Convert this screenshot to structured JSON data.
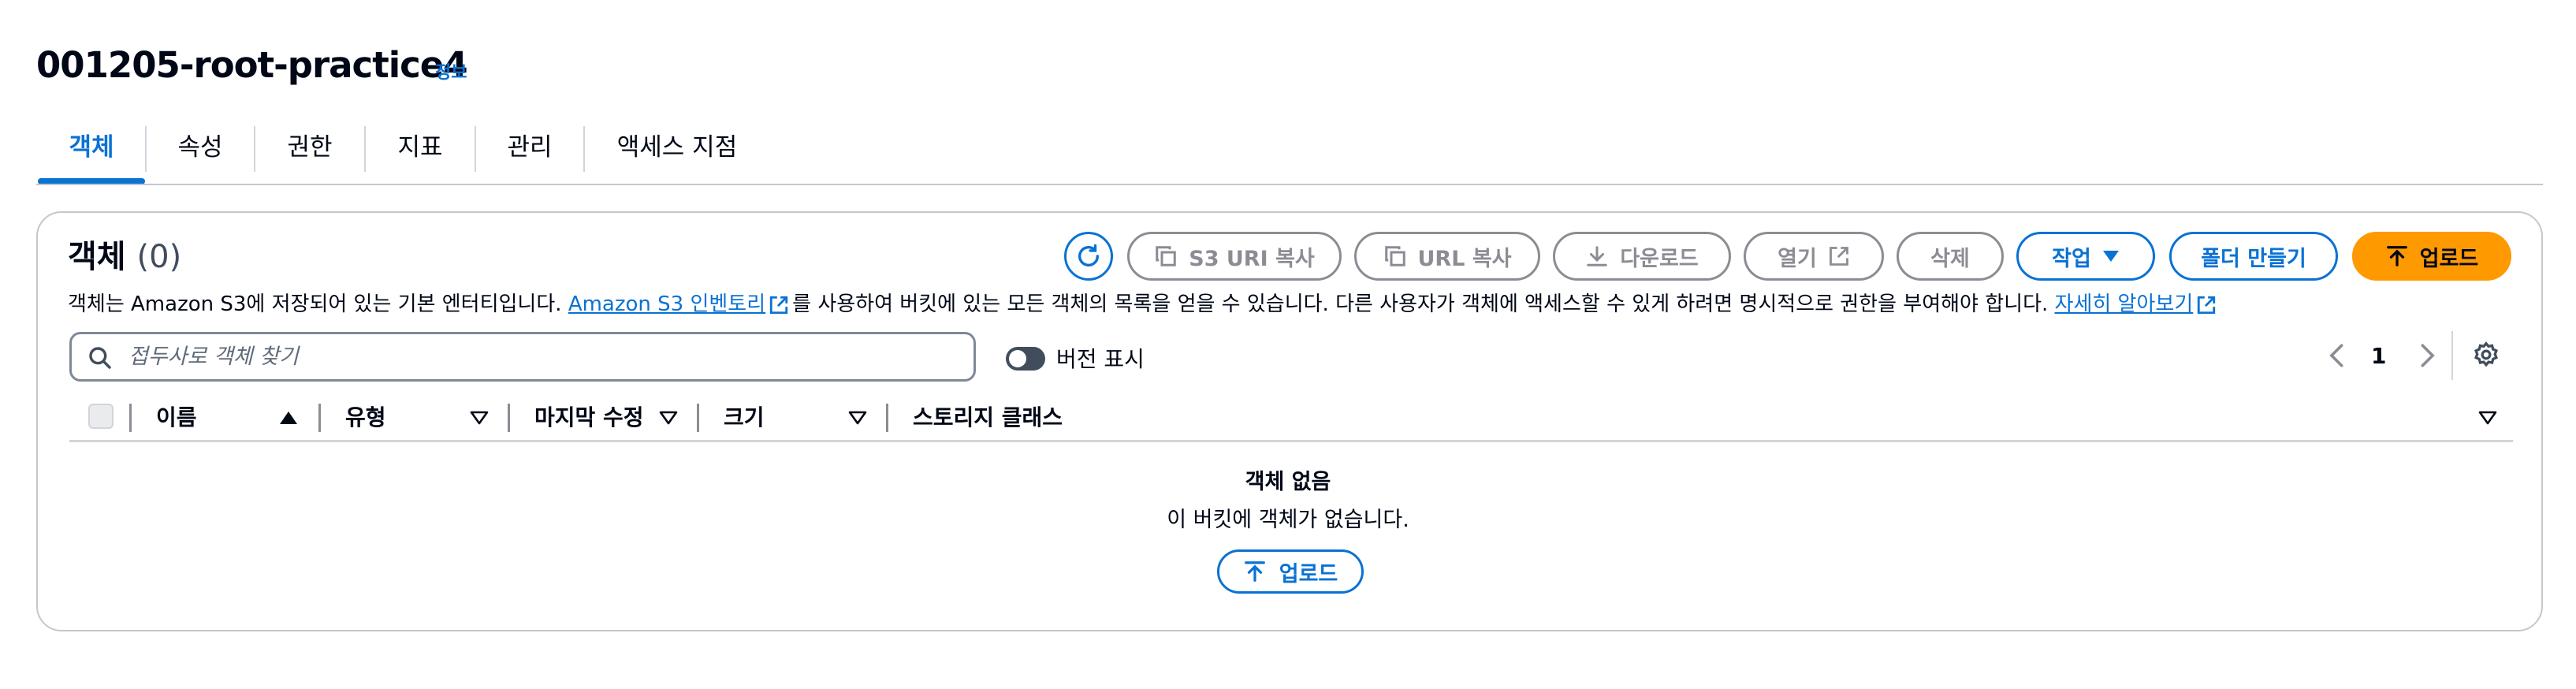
{
  "header": {
    "title": "001205-root-practice4",
    "info_link": "정보"
  },
  "tabs": [
    {
      "label": "객체",
      "active": true
    },
    {
      "label": "속성"
    },
    {
      "label": "권한"
    },
    {
      "label": "지표"
    },
    {
      "label": "관리"
    },
    {
      "label": "액세스 지점"
    }
  ],
  "panel": {
    "heading": "객체",
    "count": "(0)",
    "description_pre": "객체는 Amazon S3에 저장되어 있는 기본 엔터티입니다. ",
    "inventory_link": "Amazon S3 인벤토리",
    "description_mid": "를 사용하여 버킷에 있는 모든 객체의 목록을 얻을 수 있습니다. 다른 사용자가 객체에 액세스할 수 있게 하려면 명시적으로 권한을 부여해야 합니다. ",
    "learn_more_link": "자세히 알아보기"
  },
  "toolbar": {
    "copy_s3_uri": "S3 URI 복사",
    "copy_url": "URL 복사",
    "download": "다운로드",
    "open": "열기",
    "delete": "삭제",
    "actions": "작업",
    "create_folder": "폴더 만들기",
    "upload": "업로드"
  },
  "search": {
    "placeholder": "접두사로 객체 찾기"
  },
  "versions_toggle": {
    "label": "버전 표시",
    "on": false
  },
  "pagination": {
    "page": "1"
  },
  "table": {
    "columns": [
      "이름",
      "유형",
      "마지막 수정",
      "크기",
      "스토리지 클래스"
    ],
    "rows": []
  },
  "empty_state": {
    "title": "객체 없음",
    "description": "이 버킷에 객체가 없습니다.",
    "upload_label": "업로드"
  },
  "colors": {
    "accent": "#0972d3",
    "primary": "#ff9900",
    "disabled": "#8c8c94"
  }
}
